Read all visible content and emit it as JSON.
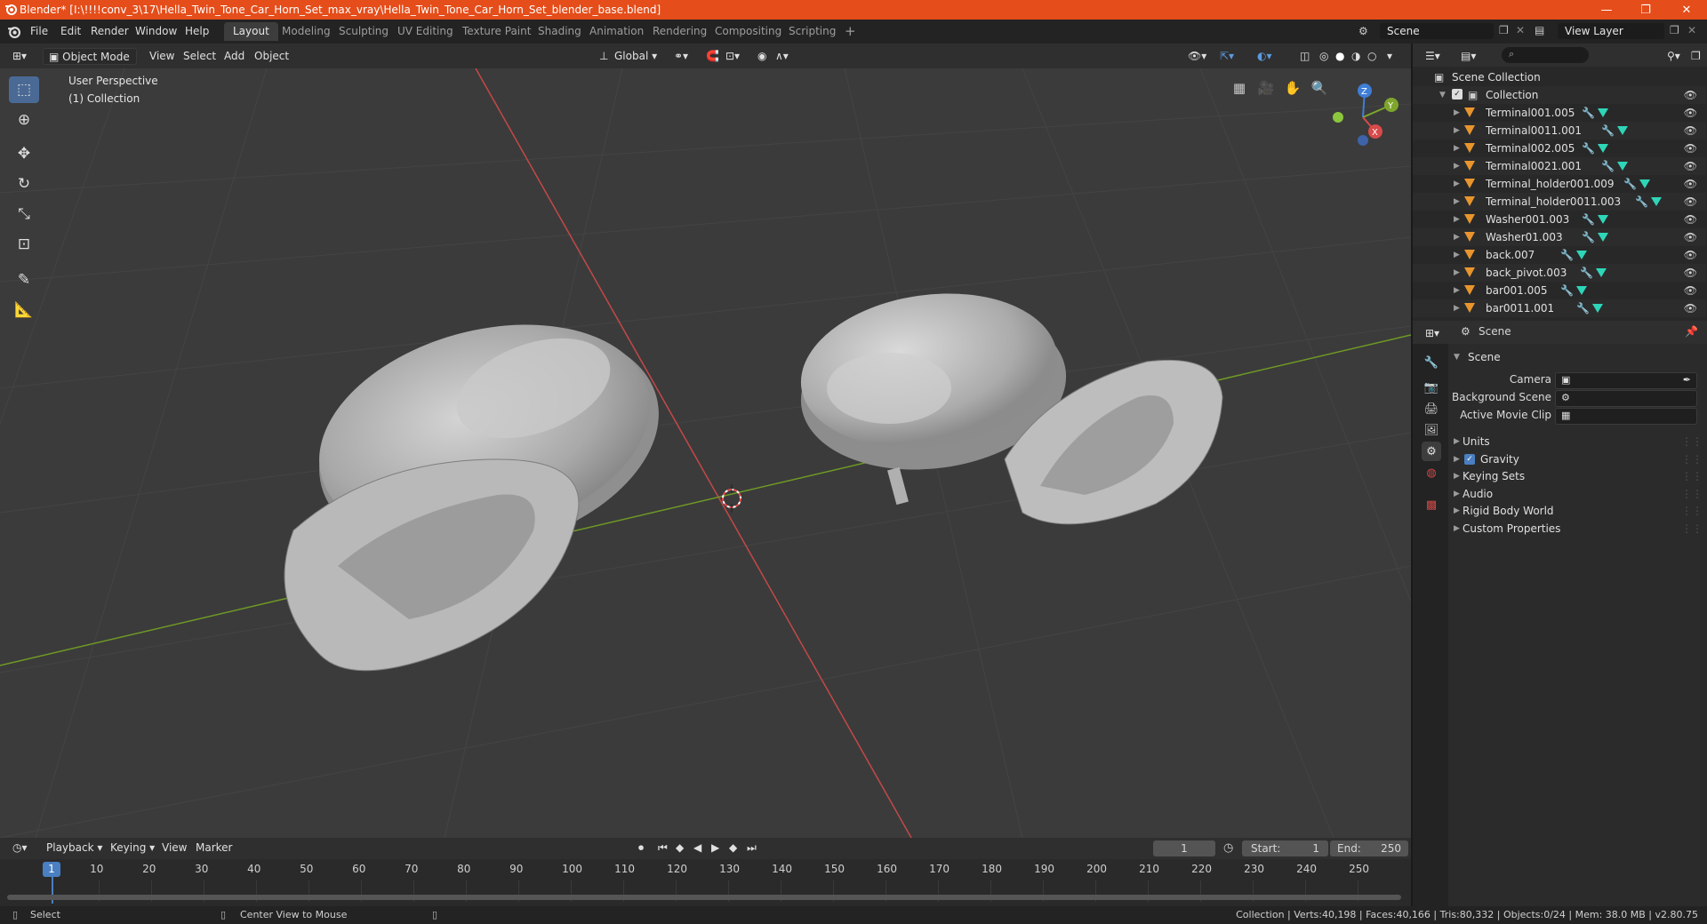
{
  "window": {
    "title": "Blender* [I:\\!!!!conv_3\\17\\Hella_Twin_Tone_Car_Horn_Set_max_vray\\Hella_Twin_Tone_Car_Horn_Set_blender_base.blend]",
    "controls": [
      "—",
      "❐",
      "✕"
    ]
  },
  "menu": [
    "File",
    "Edit",
    "Render",
    "Window",
    "Help"
  ],
  "workspaces": [
    {
      "label": "Layout",
      "active": true
    },
    {
      "label": "Modeling",
      "active": false
    },
    {
      "label": "Sculpting",
      "active": false
    },
    {
      "label": "UV Editing",
      "active": false
    },
    {
      "label": "Texture Paint",
      "active": false
    },
    {
      "label": "Shading",
      "active": false
    },
    {
      "label": "Animation",
      "active": false
    },
    {
      "label": "Rendering",
      "active": false
    },
    {
      "label": "Compositing",
      "active": false
    },
    {
      "label": "Scripting",
      "active": false
    }
  ],
  "add_workspace": "+",
  "scene_field": "Scene",
  "view_layer_field": "View Layer",
  "viewport_header": {
    "mode": "Object Mode",
    "menus": [
      "View",
      "Select",
      "Add",
      "Object"
    ],
    "orientation": "Global"
  },
  "viewport_overlay": {
    "perspective": "User Perspective",
    "collection": "(1) Collection"
  },
  "gizmo": {
    "z": "Z",
    "y": "Y",
    "x": "X"
  },
  "outliner": {
    "root": "Scene Collection",
    "collection": "Collection",
    "items": [
      "Terminal001.005",
      "Terminal0011.001",
      "Terminal002.005",
      "Terminal0021.001",
      "Terminal_holder001.009",
      "Terminal_holder0011.003",
      "Washer001.003",
      "Washer01.003",
      "back.007",
      "back_pivot.003",
      "bar001.005",
      "bar0011.001"
    ]
  },
  "properties": {
    "breadcrumb": "Scene",
    "panel": "Scene",
    "fields": [
      {
        "label": "Camera"
      },
      {
        "label": "Background Scene"
      },
      {
        "label": "Active Movie Clip"
      }
    ],
    "sections": [
      {
        "label": "Units",
        "checkbox": false
      },
      {
        "label": "Gravity",
        "checkbox": true
      },
      {
        "label": "Keying Sets",
        "checkbox": false
      },
      {
        "label": "Audio",
        "checkbox": false
      },
      {
        "label": "Rigid Body World",
        "checkbox": false
      },
      {
        "label": "Custom Properties",
        "checkbox": false
      }
    ]
  },
  "timeline": {
    "menus": [
      "Playback",
      "Keying",
      "View",
      "Marker"
    ],
    "current_frame": "1",
    "start_label": "Start:",
    "start": "1",
    "end_label": "End:",
    "end": "250",
    "ruler": [
      "1",
      "10",
      "20",
      "30",
      "40",
      "50",
      "60",
      "70",
      "80",
      "90",
      "100",
      "110",
      "120",
      "130",
      "140",
      "150",
      "160",
      "170",
      "180",
      "190",
      "200",
      "210",
      "220",
      "230",
      "240",
      "250"
    ]
  },
  "statusbar": {
    "left": "Select",
    "middle": "Center View to Mouse",
    "right": "Collection | Verts:40,198 | Faces:40,166 | Tris:80,332 | Objects:0/24 | Mem: 38.0 MB | v2.80.75"
  },
  "colors": {
    "titlebar": "#e54d1a",
    "viewport": "#3b3b3b",
    "accent": "#4a6a95",
    "object_icon": "#e8952e",
    "mesh_icon": "#2ed6b8",
    "x_axis": "#d94a4a",
    "y_axis": "#7ea62c"
  }
}
